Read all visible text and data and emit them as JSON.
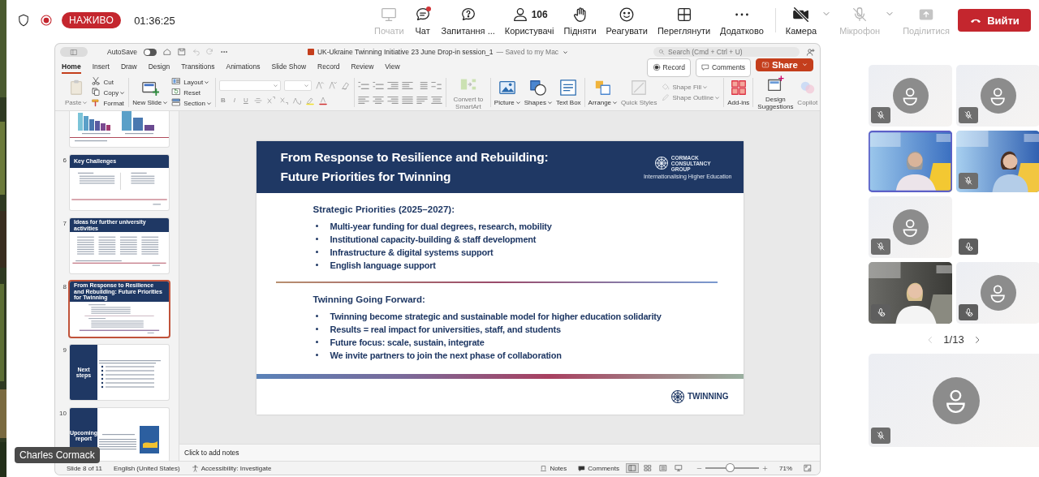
{
  "meeting_bar": {
    "live_badge": "НАЖИВО",
    "timer": "01:36:25",
    "tools": [
      {
        "kind": "start",
        "label": "Почати",
        "disabled": true,
        "notification": false
      },
      {
        "kind": "chat",
        "label": "Чат",
        "disabled": false,
        "notification": true
      },
      {
        "kind": "qa",
        "label": "Запитання ...",
        "disabled": false,
        "notification": false
      },
      {
        "kind": "people",
        "label": "Користувачі",
        "count": "106",
        "disabled": false,
        "notification": false
      },
      {
        "kind": "raise",
        "label": "Підняти",
        "disabled": false,
        "notification": false
      },
      {
        "kind": "react",
        "label": "Реагувати",
        "disabled": false,
        "notification": false
      },
      {
        "kind": "view",
        "label": "Переглянути",
        "disabled": false,
        "notification": false
      },
      {
        "kind": "more",
        "label": "Додатково",
        "disabled": false,
        "notification": false
      }
    ],
    "devices": [
      {
        "kind": "camera",
        "label": "Камера",
        "disabled": false,
        "menu": true
      },
      {
        "kind": "mic",
        "label": "Мікрофон",
        "disabled": true,
        "menu": true
      },
      {
        "kind": "share",
        "label": "Поділитися",
        "disabled": true,
        "menu": false
      }
    ],
    "leave_button": "Вийти"
  },
  "presentation": {
    "title_bar": {
      "autosave_label": "AutoSave",
      "autosave_on": false,
      "title": "UK-Ukraine Twinning Initiative 23 June Drop-in session_1",
      "save_status": "— Saved to my Mac",
      "search_placeholder": "Search (Cmd + Ctrl + U)"
    },
    "tabs": [
      {
        "label": "Home",
        "selected": true
      },
      {
        "label": "Insert",
        "selected": false
      },
      {
        "label": "Draw",
        "selected": false
      },
      {
        "label": "Design",
        "selected": false
      },
      {
        "label": "Transitions",
        "selected": false
      },
      {
        "label": "Animations",
        "selected": false
      },
      {
        "label": "Slide Show",
        "selected": false
      },
      {
        "label": "Record",
        "selected": false
      },
      {
        "label": "Review",
        "selected": false
      },
      {
        "label": "View",
        "selected": false
      }
    ],
    "actions": [
      {
        "kind": "record",
        "label": "Record"
      },
      {
        "kind": "comments",
        "label": "Comments"
      },
      {
        "kind": "share",
        "label": "Share"
      }
    ],
    "ribbon": [
      {
        "kind": "items",
        "items": [
          {
            "label": "Paste",
            "disabled": true,
            "menu": true
          },
          {
            "label": "Cut",
            "disabled": false,
            "menu": false
          },
          {
            "label": "Copy",
            "disabled": false,
            "menu": true
          },
          {
            "label": "Format",
            "disabled": false,
            "menu": false
          }
        ]
      },
      {
        "kind": "items",
        "items": [
          {
            "label": "New Slide",
            "disabled": false,
            "menu": true
          },
          {
            "label": "Layout",
            "disabled": false,
            "menu": true
          },
          {
            "label": "Reset",
            "disabled": false,
            "menu": false
          },
          {
            "label": "Section",
            "disabled": false,
            "menu": true
          }
        ]
      },
      {
        "kind": "font",
        "format_buttons": [
          "B",
          "I",
          "U"
        ]
      },
      {
        "kind": "paragraph"
      },
      {
        "kind": "items",
        "items": [
          {
            "label": "Convert to SmartArt",
            "disabled": true,
            "menu": false
          }
        ]
      },
      {
        "kind": "items",
        "items": [
          {
            "label": "Picture",
            "disabled": false,
            "menu": true
          },
          {
            "label": "Shapes",
            "disabled": false,
            "menu": true
          },
          {
            "label": "Text Box",
            "disabled": false,
            "menu": false
          }
        ]
      },
      {
        "kind": "items",
        "items": [
          {
            "label": "Arrange",
            "disabled": false,
            "menu": true
          },
          {
            "label": "Quick Styles",
            "disabled": true,
            "menu": false
          },
          {
            "label": "Shape Fill",
            "disabled": true,
            "menu": true
          },
          {
            "label": "Shape Outline",
            "disabled": true,
            "menu": true
          }
        ]
      },
      {
        "kind": "items",
        "items": [
          {
            "label": "Add-ins",
            "disabled": false,
            "menu": false
          }
        ]
      },
      {
        "kind": "items",
        "items": [
          {
            "label": "Design Suggestions",
            "disabled": false,
            "menu": false
          },
          {
            "label": "Copilot",
            "disabled": true,
            "menu": false
          }
        ]
      }
    ],
    "thumbnails": [
      {
        "selected": false
      },
      {
        "number": "6",
        "title": "Key Challenges",
        "selected": false
      },
      {
        "number": "7",
        "title": "Ideas for further university activities",
        "selected": false
      },
      {
        "number": "8",
        "title": "From Response to Resilience and Rebuilding: Future Priorities for Twinning",
        "selected": true
      },
      {
        "number": "9",
        "title": "Next steps",
        "selected": false
      },
      {
        "number": "10",
        "title": "Upcoming report",
        "selected": false
      }
    ],
    "slide": {
      "title_lines": [
        "From Response to Resilience and Rebuilding:",
        "Future Priorities for Twinning"
      ],
      "logo_text": "CORMACK CONSULTANCY GROUP",
      "logo_tagline": "Internationalising Higher Education",
      "sections": [
        {
          "heading": "Strategic Priorities (2025–2027):",
          "bullets": [
            "Multi-year funding for dual degrees, research, mobility",
            "Institutional capacity-building & staff development",
            "Infrastructure & digital systems support",
            "English language support"
          ]
        },
        {
          "heading": "Twinning Going Forward:",
          "bullets": [
            "Twinning become strategic and sustainable model for higher education solidarity",
            "Results = real impact for universities, staff, and students",
            "Future focus: scale, sustain, integrate",
            "We invite partners to join the next phase of collaboration"
          ]
        }
      ],
      "footer_logo": "TWINNING"
    },
    "notes_placeholder": "Click to add notes",
    "status_bar": {
      "slide_counter": "Slide 8 of 11",
      "language": "English (United States)",
      "accessibility": "Accessibility: Investigate",
      "notes": "Notes",
      "comments": "Comments",
      "views": [
        {
          "kind": "normal",
          "selected": true
        },
        {
          "kind": "sorter",
          "selected": false
        },
        {
          "kind": "reading",
          "selected": false
        },
        {
          "kind": "slideshow",
          "selected": false
        }
      ],
      "zoom": {
        "level": 0.45,
        "reading": "71%"
      }
    }
  },
  "participants": {
    "tiles": [
      {
        "kind": "avatar",
        "muted": true,
        "mic_disabled": false,
        "speaking": false
      },
      {
        "kind": "avatar",
        "muted": true,
        "mic_disabled": false,
        "speaking": false
      },
      {
        "kind": "video",
        "muted": false,
        "mic_disabled": false,
        "speaking": true
      },
      {
        "kind": "video",
        "muted": true,
        "mic_disabled": false,
        "speaking": false
      },
      {
        "kind": "avatar",
        "muted": true,
        "mic_disabled": false,
        "speaking": false
      },
      {
        "kind": "empty",
        "muted": false,
        "mic_disabled": true,
        "speaking": false
      },
      {
        "kind": "video",
        "muted": false,
        "mic_disabled": true,
        "speaking": false
      },
      {
        "kind": "avatar",
        "muted": false,
        "mic_disabled": true,
        "speaking": false
      }
    ],
    "pager": "1/13",
    "featured": {
      "kind": "avatar",
      "muted": true,
      "mic_disabled": false,
      "speaking": false
    }
  },
  "name_tag": "Charles Cormack"
}
